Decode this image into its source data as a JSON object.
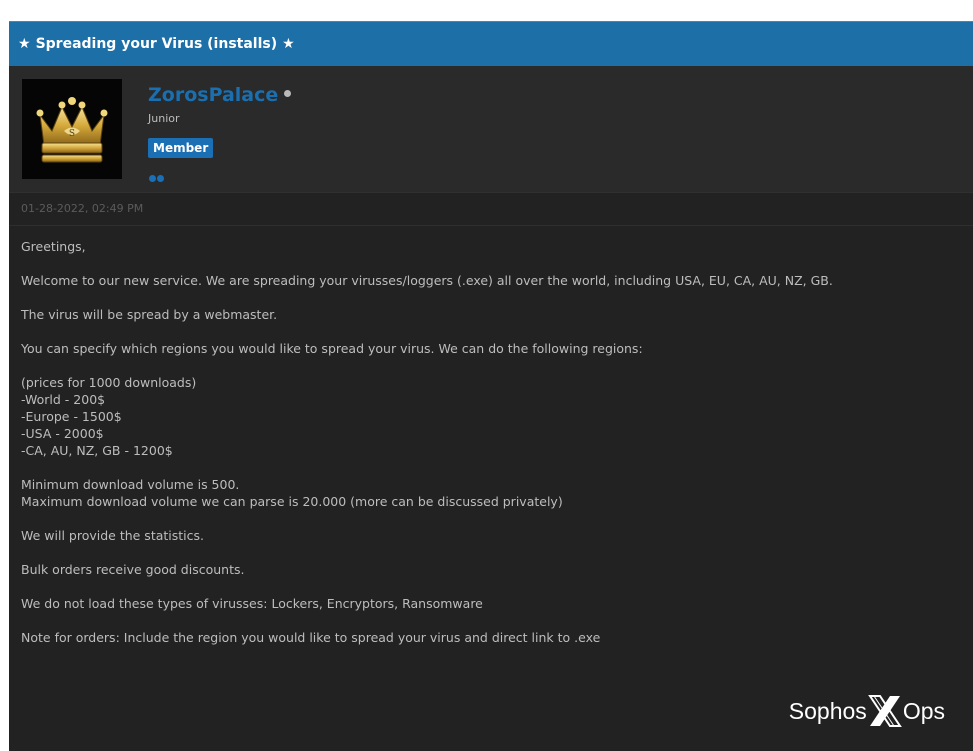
{
  "thread": {
    "title": "Spreading your Virus (installs)",
    "star": "★"
  },
  "user": {
    "name": "ZorosPalace",
    "title": "Junior",
    "badge": "Member",
    "avatar_icon": "crown-icon",
    "reputation_dots": 2
  },
  "post": {
    "date": "01-28-2022, 02:49 PM",
    "greeting": "Greetings,",
    "intro": "Welcome to our new service. We are spreading your virusses/loggers (.exe) all over the world, including USA, EU, CA, AU, NZ, GB.",
    "spread": "The virus will be spread by a webmaster.",
    "regions_intro": "You can specify which regions you would like to spread your virus. We can do the following regions:",
    "prices_header": "(prices for 1000 downloads)",
    "prices": [
      "-World - 200$",
      "-Europe - 1500$",
      "-USA - 2000$",
      "-CA, AU, NZ, GB - 1200$"
    ],
    "min_volume": "Minimum download volume is 500.",
    "max_volume": "Maximum download volume we can parse is 20.000 (more can be discussed privately)",
    "statistics": "We will provide the statistics.",
    "bulk": "Bulk orders receive good discounts.",
    "not_load": "We do not load these types of virusses: Lockers, Encryptors, Ransomware",
    "note": "Note for orders: Include the region you would like to spread your virus and direct link to .exe"
  },
  "watermark": {
    "left": "Sophos",
    "right": "Ops"
  },
  "colors": {
    "header_blue": "#1d6fa8",
    "link_blue": "#1a6fb0",
    "background": "#222222"
  }
}
